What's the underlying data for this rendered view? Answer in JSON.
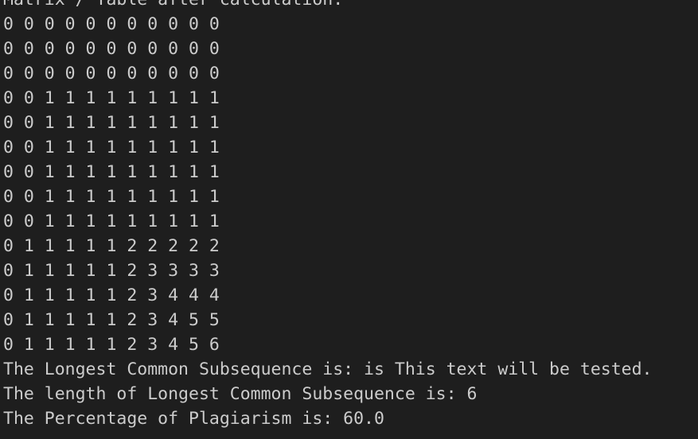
{
  "terminal": {
    "background": "#1e1e1e",
    "foreground": "#cccccc",
    "lines": [
      "Matrix / Table after calculation:",
      "0 0 0 0 0 0 0 0 0 0 0",
      "0 0 0 0 0 0 0 0 0 0 0",
      "0 0 0 0 0 0 0 0 0 0 0",
      "0 0 1 1 1 1 1 1 1 1 1",
      "0 0 1 1 1 1 1 1 1 1 1",
      "0 0 1 1 1 1 1 1 1 1 1",
      "0 0 1 1 1 1 1 1 1 1 1",
      "0 0 1 1 1 1 1 1 1 1 1",
      "0 0 1 1 1 1 1 1 1 1 1",
      "0 1 1 1 1 1 2 2 2 2 2",
      "0 1 1 1 1 1 2 3 3 3 3",
      "0 1 1 1 1 1 2 3 4 4 4",
      "0 1 1 1 1 1 2 3 4 5 5",
      "0 1 1 1 1 1 2 3 4 5 6",
      "The Longest Common Subsequence is: is This text will be tested.",
      "The length of Longest Common Subsequence is: 6",
      "The Percentage of Plagiarism is: 60.0"
    ]
  }
}
